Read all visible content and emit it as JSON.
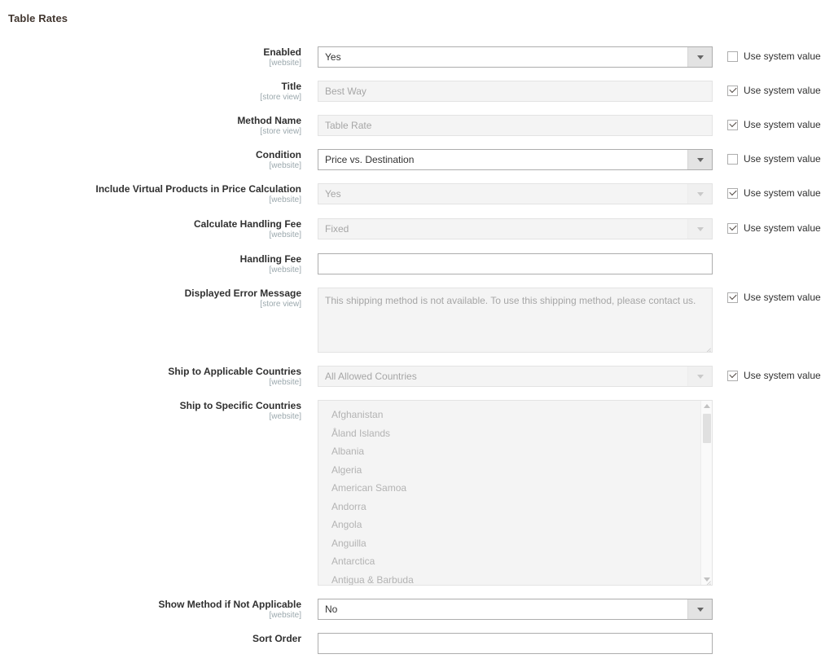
{
  "section": {
    "title": "Table Rates"
  },
  "system_value_label": "Use system value",
  "colors": {
    "label_text": "#303030",
    "scope_text": "#9ba8ad",
    "input_border": "#adadad",
    "disabled_bg": "#f4f4f4",
    "disabled_text": "#a6a6a6",
    "section_title": "#41362f"
  },
  "fields": [
    {
      "name": "enabled",
      "label": "Enabled",
      "scope": "[website]",
      "type": "select",
      "value": "Yes",
      "disabled": false,
      "system_value": {
        "present": true,
        "checked": false
      }
    },
    {
      "name": "title",
      "label": "Title",
      "scope": "[store view]",
      "type": "text",
      "value": "Best Way",
      "disabled": true,
      "system_value": {
        "present": true,
        "checked": true
      }
    },
    {
      "name": "method_name",
      "label": "Method Name",
      "scope": "[store view]",
      "type": "text",
      "value": "Table Rate",
      "disabled": true,
      "system_value": {
        "present": true,
        "checked": true
      }
    },
    {
      "name": "condition",
      "label": "Condition",
      "scope": "[website]",
      "type": "select",
      "value": "Price vs. Destination",
      "disabled": false,
      "system_value": {
        "present": true,
        "checked": false
      }
    },
    {
      "name": "include_virtual_products",
      "label": "Include Virtual Products in Price Calculation",
      "scope": "[website]",
      "type": "select",
      "value": "Yes",
      "disabled": true,
      "system_value": {
        "present": true,
        "checked": true
      }
    },
    {
      "name": "calculate_handling_fee",
      "label": "Calculate Handling Fee",
      "scope": "[website]",
      "type": "select",
      "value": "Fixed",
      "disabled": true,
      "system_value": {
        "present": true,
        "checked": true
      }
    },
    {
      "name": "handling_fee",
      "label": "Handling Fee",
      "scope": "[website]",
      "type": "text",
      "value": "",
      "disabled": false,
      "system_value": {
        "present": false,
        "checked": false
      }
    },
    {
      "name": "displayed_error_message",
      "label": "Displayed Error Message",
      "scope": "[store view]",
      "type": "textarea",
      "value": "This shipping method is not available. To use this shipping method, please contact us.",
      "disabled": true,
      "system_value": {
        "present": true,
        "checked": true
      }
    },
    {
      "name": "ship_to_applicable_countries",
      "label": "Ship to Applicable Countries",
      "scope": "[website]",
      "type": "select",
      "value": "All Allowed Countries",
      "disabled": true,
      "system_value": {
        "present": true,
        "checked": true
      }
    },
    {
      "name": "ship_to_specific_countries",
      "label": "Ship to Specific Countries",
      "scope": "[website]",
      "type": "multiselect",
      "options": [
        "Afghanistan",
        "Åland Islands",
        "Albania",
        "Algeria",
        "American Samoa",
        "Andorra",
        "Angola",
        "Anguilla",
        "Antarctica",
        "Antigua & Barbuda"
      ],
      "disabled": true,
      "system_value": {
        "present": false,
        "checked": false
      }
    },
    {
      "name": "show_method_if_not_applicable",
      "label": "Show Method if Not Applicable",
      "scope": "[website]",
      "type": "select",
      "value": "No",
      "disabled": false,
      "system_value": {
        "present": false,
        "checked": false
      }
    },
    {
      "name": "sort_order",
      "label": "Sort Order",
      "scope": "",
      "type": "text",
      "value": "",
      "disabled": false,
      "system_value": {
        "present": false,
        "checked": false
      }
    }
  ]
}
